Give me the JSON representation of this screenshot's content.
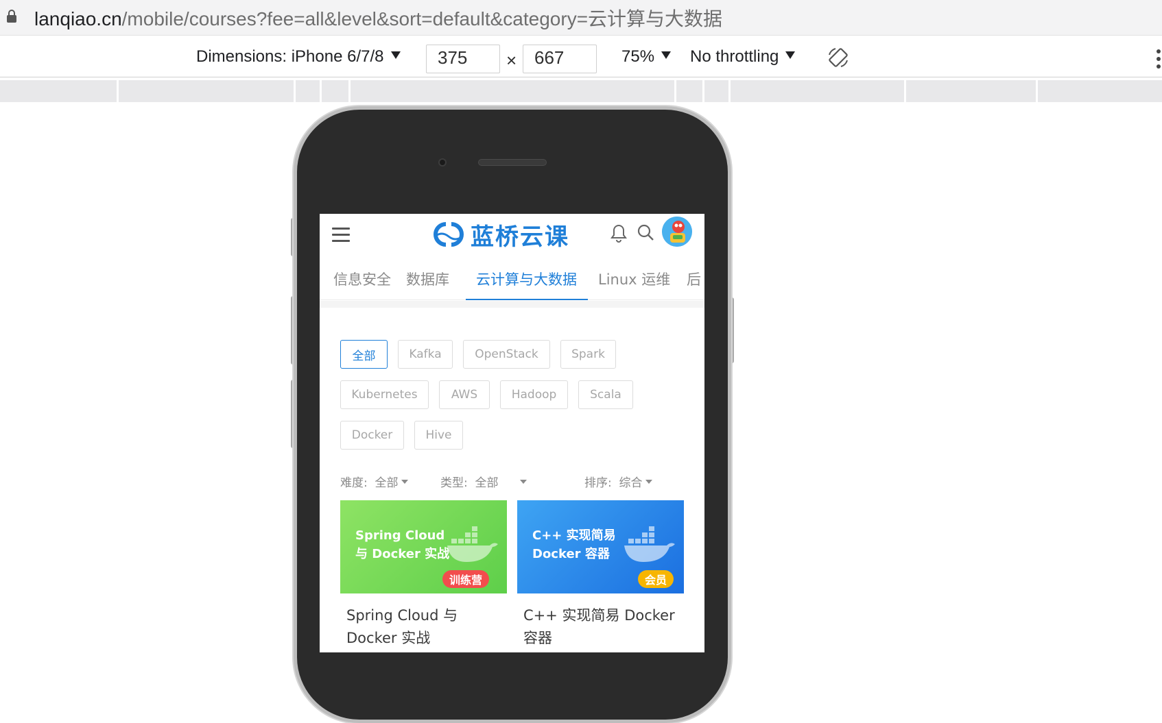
{
  "browser": {
    "url_host": "lanqiao.cn",
    "url_path": "/mobile/courses?fee=all&level&sort=default&category=云计算与大数据"
  },
  "device_toolbar": {
    "dimensions_label": "Dimensions: iPhone 6/7/8",
    "width": "375",
    "times": "×",
    "height": "667",
    "zoom": "75%",
    "throttling": "No throttling",
    "rotate_icon": "rotate-icon",
    "more_icon": "kebab-icon"
  },
  "app": {
    "brand": "蓝桥云课",
    "brand_color": "#1f7fd8",
    "icons": [
      "menu-icon",
      "bell-icon",
      "search-icon",
      "avatar"
    ]
  },
  "categories": [
    {
      "label": "信息安全",
      "active": false
    },
    {
      "label": "数据库",
      "active": false
    },
    {
      "label": "云计算与大数据",
      "active": true
    },
    {
      "label": "Linux 运维",
      "active": false
    },
    {
      "label": "后",
      "active": false
    }
  ],
  "tags": [
    {
      "label": "全部",
      "active": true
    },
    {
      "label": "Kafka",
      "active": false
    },
    {
      "label": "OpenStack",
      "active": false
    },
    {
      "label": "Spark",
      "active": false
    },
    {
      "label": "Kubernetes",
      "active": false
    },
    {
      "label": "AWS",
      "active": false
    },
    {
      "label": "Hadoop",
      "active": false
    },
    {
      "label": "Scala",
      "active": false
    },
    {
      "label": "Docker",
      "active": false
    },
    {
      "label": "Hive",
      "active": false
    }
  ],
  "filters": {
    "difficulty_label": "难度:",
    "difficulty_value": "全部",
    "type_label": "类型:",
    "type_value": "全部",
    "sort_label": "排序:",
    "sort_value": "综合"
  },
  "courses": [
    {
      "cover_line1": "Spring Cloud",
      "cover_line2": "与 Docker 实战",
      "badge": "训练营",
      "badge_color": "#f24d4d",
      "title": "Spring Cloud 与 Docker 实战",
      "cover_color": "#6fd852"
    },
    {
      "cover_line1": "C++ 实现简易",
      "cover_line2": "Docker 容器",
      "badge": "会员",
      "badge_color": "#f7b500",
      "title": "C++ 实现简易 Docker 容器",
      "cover_color": "#2b88ea"
    }
  ]
}
